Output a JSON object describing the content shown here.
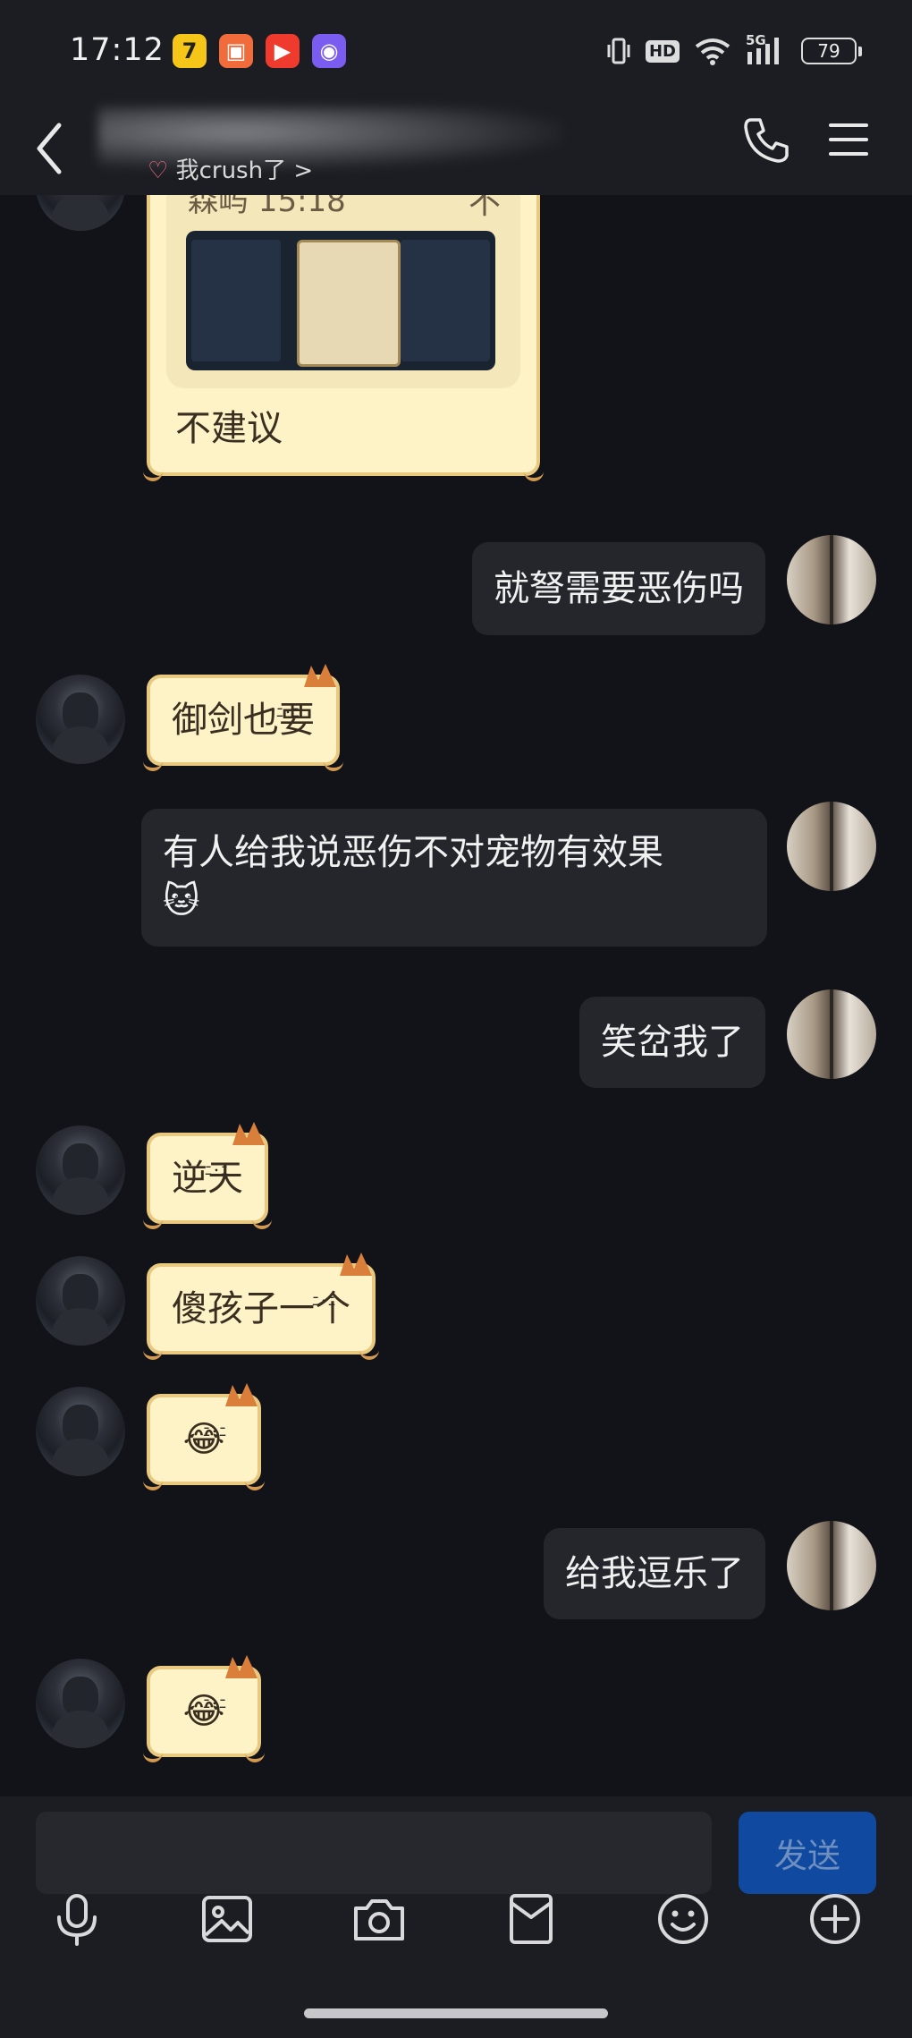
{
  "status_bar": {
    "time": "17:12",
    "battery": "79",
    "network_label": "5G",
    "hd_label": "HD",
    "app_icons": [
      "app-7-icon",
      "app-orange-icon",
      "app-video-icon",
      "app-purple-icon"
    ]
  },
  "header": {
    "subtitle": "我crush了 >",
    "icons": [
      "back-icon",
      "phone-icon",
      "menu-icon"
    ]
  },
  "quoted_message": {
    "sender_time": "森屿 15:18",
    "reply_text": "不建议"
  },
  "messages": [
    {
      "side": "me",
      "text": "就弩需要恶伤吗"
    },
    {
      "side": "them",
      "text": "御剑也要"
    },
    {
      "side": "me",
      "text": "有人给我说恶伤不对宠物有效果",
      "emoji": "🐱"
    },
    {
      "side": "me",
      "text": "笑岔我了"
    },
    {
      "side": "them",
      "text": "逆天"
    },
    {
      "side": "them",
      "text": "傻孩子一个"
    },
    {
      "side": "them",
      "text": "😂"
    },
    {
      "side": "me",
      "text": "给我逗乐了"
    },
    {
      "side": "them",
      "text": "😂"
    }
  ],
  "input_bar": {
    "send_label": "发送",
    "tools": [
      "microphone-icon",
      "image-icon",
      "camera-icon",
      "red-packet-icon",
      "emoji-icon",
      "plus-icon"
    ]
  },
  "colors": {
    "background": "#111318",
    "my_bubble": "#24262b",
    "cat_bubble": "#fdf3c6",
    "send_button": "#0f4aa0"
  }
}
